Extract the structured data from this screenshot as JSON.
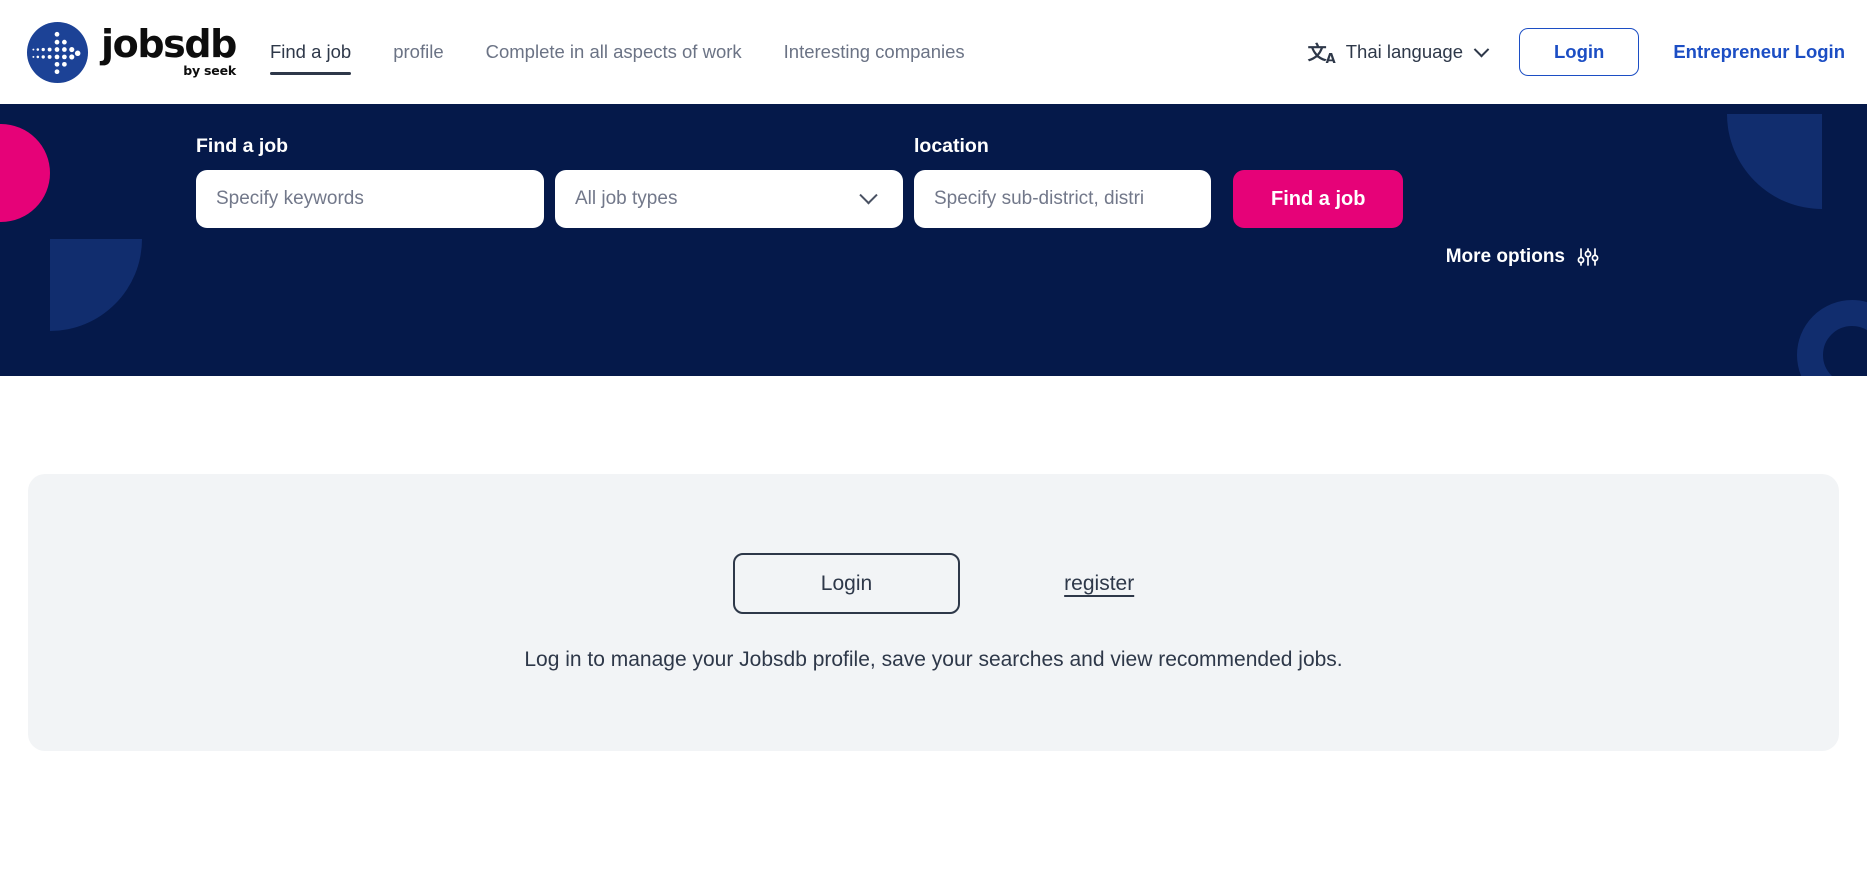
{
  "brand": {
    "wordmark": "jobsdb",
    "tagline": "by seek",
    "logo_icon": "jobsdb-dot-arrow-logo",
    "logo_color": "#1c4296"
  },
  "nav": {
    "links": [
      {
        "label": "Find a job",
        "active": true
      },
      {
        "label": "profile",
        "active": false
      },
      {
        "label": "Complete in all aspects of work",
        "active": false
      },
      {
        "label": "Interesting companies",
        "active": false
      }
    ],
    "language": {
      "icon": "translate-icon",
      "icon_cjk": "文",
      "icon_latin": "A",
      "label": "Thai language",
      "chevron_icon": "chevron-down-icon"
    },
    "login_label": "Login",
    "employer_login_label": "Entrepreneur Login",
    "accent_color": "#1c4ec4"
  },
  "hero": {
    "background_color": "#05194a",
    "accent_pink": "#e60278",
    "shape_blue": "#112d6e",
    "labels": {
      "find_a_job": "Find a job",
      "location": "location"
    },
    "keywords_placeholder": "Specify keywords",
    "job_type_value": "All job types",
    "job_type_chevron_icon": "chevron-down-icon",
    "location_placeholder": "Specify sub-district, distri",
    "search_button_label": "Find a job",
    "more_options_label": "More options",
    "more_options_icon": "sliders-icon"
  },
  "main": {
    "login_card": {
      "login_button_label": "Login",
      "register_link_label": "register",
      "caption": "Log in to manage your Jobsdb profile, save your searches and view recommended jobs.",
      "background_color": "#f2f4f6"
    }
  }
}
